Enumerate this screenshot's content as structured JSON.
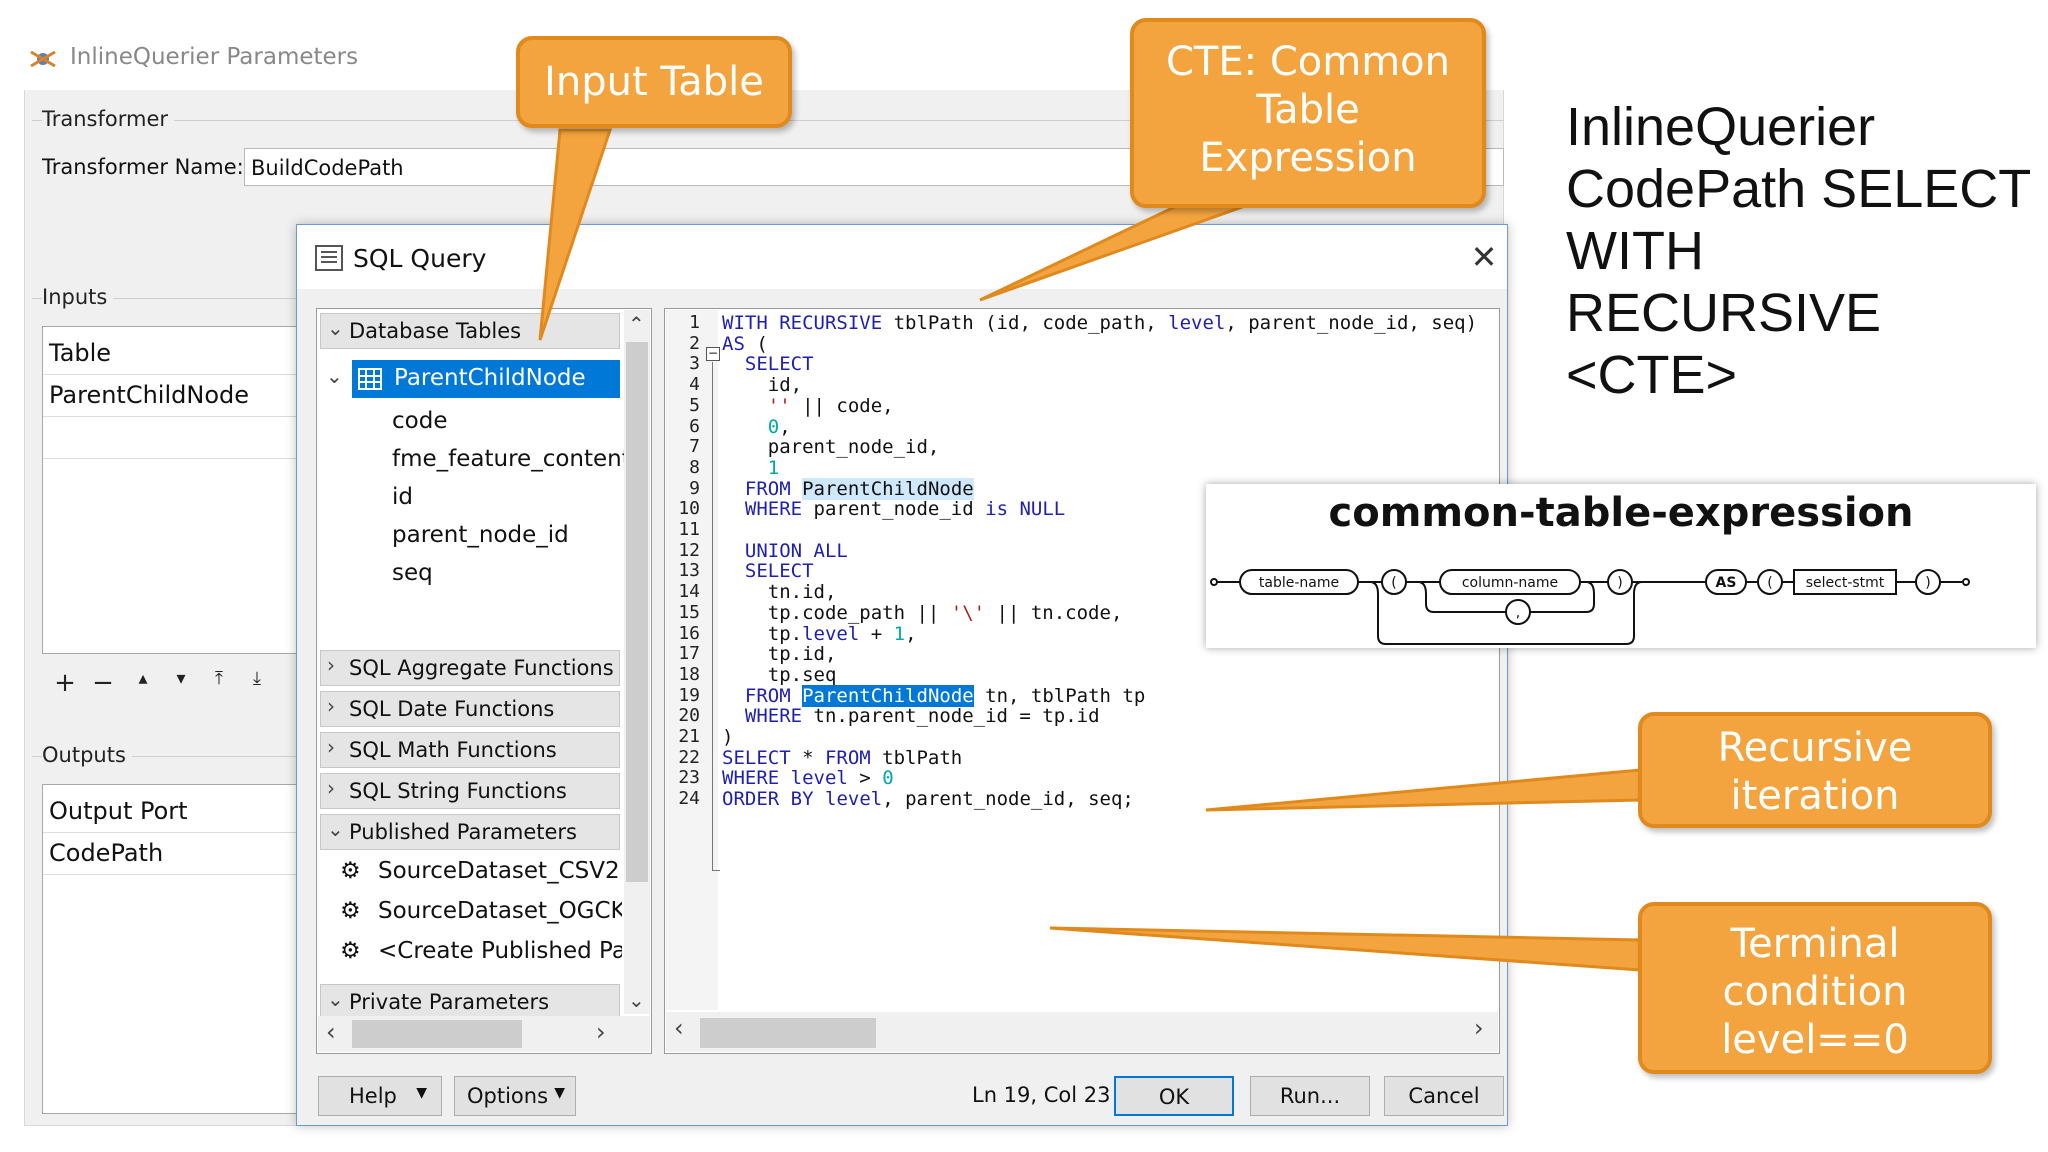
{
  "bg_dialog": {
    "title": "InlineQuerier Parameters",
    "transformer_group": "Transformer",
    "transformer_name_label": "Transformer Name:",
    "transformer_name_value": "BuildCodePath",
    "inputs_group": "Inputs",
    "inputs_rows": [
      "Table",
      "ParentChildNode"
    ],
    "outputs_group": "Outputs",
    "outputs_rows": [
      "Output Port",
      "CodePath"
    ],
    "list_controls": [
      "+",
      "−",
      "▴",
      "▾",
      "⤒",
      "⤓"
    ]
  },
  "sql_dialog": {
    "title": "SQL Query",
    "close_icon": "close-icon",
    "tree": {
      "database_tables": "Database Tables",
      "selected_table": "ParentChildNode",
      "columns": [
        "code",
        "fme_feature_content",
        "id",
        "parent_node_id",
        "seq"
      ],
      "sections": [
        "SQL Aggregate Functions",
        "SQL Date Functions",
        "SQL Math Functions",
        "SQL String Functions"
      ],
      "published_parameters": "Published Parameters",
      "published_items": [
        "SourceDataset_CSV2",
        "SourceDataset_OGCKI",
        "<Create Published Par"
      ],
      "private_parameters": "Private Parameters"
    },
    "code_lines": [
      "WITH RECURSIVE tblPath (id, code_path, level, parent_node_id, seq)",
      "AS (",
      "  SELECT",
      "    id,",
      "    '' || code,",
      "    0,",
      "    parent_node_id,",
      "    1",
      "  FROM ParentChildNode",
      "  WHERE parent_node_id is NULL",
      "",
      "  UNION ALL",
      "  SELECT",
      "    tn.id,",
      "    tp.code_path || '\\' || tn.code,",
      "    tp.level + 1,",
      "    tp.id,",
      "    tp.seq",
      "  FROM ParentChildNode tn, tblPath tp",
      "  WHERE tn.parent_node_id = tp.id",
      ")",
      "SELECT * FROM tblPath",
      "WHERE level > 0",
      "ORDER BY level, parent_node_id, seq;"
    ],
    "buttons": {
      "help": "Help",
      "options": "Options",
      "ok": "OK",
      "run": "Run...",
      "cancel": "Cancel"
    },
    "status": "Ln 19, Col 23"
  },
  "callouts": {
    "input_table": "Input Table",
    "cte": "CTE: Common Table Expression",
    "recursive": "Recursive iteration",
    "terminal": "Terminal condition level==0"
  },
  "headline": "InlineQuerier\nCodePath SELECT\nWITH\nRECURSIVE\n<CTE>",
  "railroad": {
    "title": "common-table-expression",
    "nodes": [
      "table-name",
      "(",
      "column-name",
      ",",
      ")",
      "AS",
      "(",
      "select-stmt",
      ")"
    ]
  },
  "colors": {
    "callout": "#f4a43e",
    "selection": "#0078d7",
    "keyword": "#1f1fb0"
  }
}
